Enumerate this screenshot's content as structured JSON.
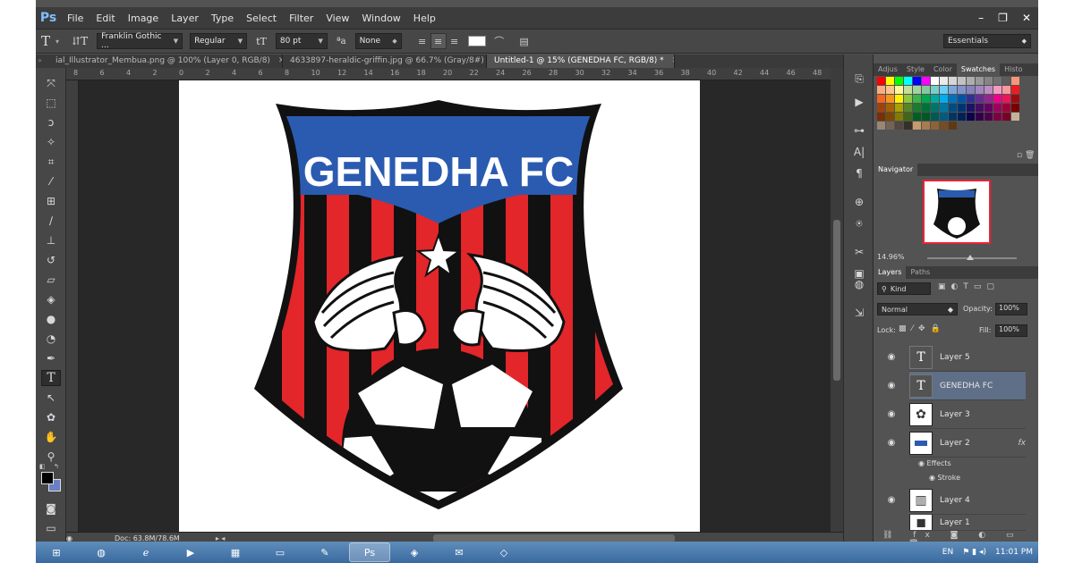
{
  "app": {
    "logo": "Ps",
    "menu": [
      "File",
      "Edit",
      "Image",
      "Layer",
      "Type",
      "Select",
      "Filter",
      "View",
      "Window",
      "Help"
    ]
  },
  "window_controls": [
    "–",
    "❐",
    "✕"
  ],
  "options": {
    "tool_glyph": "T",
    "orient_glyph": "⇵T",
    "font_family": "Franklin Gothic ...",
    "font_style": "Regular",
    "size_glyph": "tT",
    "font_size": "80 pt",
    "aa_label": "ªa",
    "anti_alias": "None",
    "workspace": "Essentials"
  },
  "tabs": [
    {
      "label": "ial_Illustrator_Membua.png @ 100% (Layer 0, RGB/8)",
      "close": "✕"
    },
    {
      "label": "4633897-heraldic-griffin.jpg @ 66.7% (Gray/8#)",
      "close": "✕"
    },
    {
      "label": "Untitled-1 @ 15% (GENEDHA FC, RGB/8) *",
      "close": "✕"
    }
  ],
  "ruler_ticks": [
    "8",
    "6",
    "4",
    "2",
    "0",
    "2",
    "4",
    "6",
    "8",
    "10",
    "12",
    "14",
    "16",
    "18",
    "20",
    "22",
    "24",
    "26",
    "28",
    "30",
    "32",
    "34",
    "36",
    "38",
    "40",
    "42",
    "44",
    "46",
    "48"
  ],
  "logo": {
    "title": "GENEDHA FC",
    "colors": {
      "blue": "#2a5bb0",
      "red": "#e2262a",
      "black": "#111111"
    }
  },
  "status": {
    "doc": "Doc: 63.8M/78.6M"
  },
  "panels": {
    "color_tabs": [
      "Adjus",
      "Style",
      "Color",
      "Swatches",
      "Histo"
    ],
    "navigator_tab": "Navigator",
    "navigator_zoom": "14.96%",
    "layers_tabs": [
      "Layers",
      "Paths"
    ],
    "kind_filter": "Kind",
    "blend_mode": "Normal",
    "opacity_label": "Opacity:",
    "opacity_value": "100%",
    "lock_label": "Lock:",
    "fill_label": "Fill:",
    "fill_value": "100%",
    "layers": [
      {
        "name": "Layer 5",
        "thumb": "T",
        "type": "text"
      },
      {
        "name": "GENEDHA FC",
        "thumb": "T",
        "type": "text",
        "selected": true
      },
      {
        "name": "Layer 3",
        "thumb": "",
        "type": "image"
      },
      {
        "name": "Layer 2",
        "thumb": "",
        "type": "image",
        "fx": "fx"
      },
      {
        "name": "Effects",
        "type": "effect"
      },
      {
        "name": "Stroke",
        "type": "effect"
      },
      {
        "name": "Layer 4",
        "thumb": "",
        "type": "image"
      },
      {
        "name": "Layer 1",
        "thumb": "",
        "type": "image"
      }
    ]
  },
  "taskbar": {
    "tray_lang": "EN",
    "clock": "11:01 PM",
    "ps_label": "Ps"
  },
  "swatch_colors": [
    "#ff0000",
    "#ffff00",
    "#00ff00",
    "#00ffff",
    "#0000ff",
    "#ff00ff",
    "#ffffff",
    "#ebebeb",
    "#d6d6d6",
    "#c2c2c2",
    "#adadad",
    "#999999",
    "#858585",
    "#707070",
    "#5c5c5c",
    "#f7977a",
    "#f9ad81",
    "#fdc68a",
    "#fff79a",
    "#c4df9b",
    "#a2d39c",
    "#82ca9d",
    "#7bcdc8",
    "#6ecff6",
    "#7ea7d8",
    "#8493ca",
    "#8882be",
    "#a187be",
    "#bc8dbf",
    "#f49ac2",
    "#f6989d",
    "#ed1c24",
    "#f26522",
    "#f7941d",
    "#fff200",
    "#8dc63f",
    "#39b54a",
    "#00a651",
    "#00a99d",
    "#00aeef",
    "#0072bc",
    "#0054a6",
    "#2e3192",
    "#662d91",
    "#92278f",
    "#ec008c",
    "#ed145b",
    "#9e0b0f",
    "#a0410d",
    "#a36209",
    "#aba000",
    "#598527",
    "#1a7b30",
    "#007236",
    "#00746b",
    "#0076a3",
    "#004b80",
    "#003471",
    "#1b1464",
    "#440e62",
    "#630460",
    "#9e005d",
    "#9e0039",
    "#790000",
    "#7b2e00",
    "#7d4900",
    "#827b00",
    "#406618",
    "#005e20",
    "#005826",
    "#005952",
    "#005b7f",
    "#003663",
    "#002157",
    "#0d004c",
    "#32004b",
    "#4b0049",
    "#7b0046",
    "#7a0026",
    "#c7b299",
    "#998675",
    "#736357",
    "#534741",
    "#37302a",
    "#c69c6d",
    "#a67c52",
    "#8c6239",
    "#754c24",
    "#603913"
  ]
}
